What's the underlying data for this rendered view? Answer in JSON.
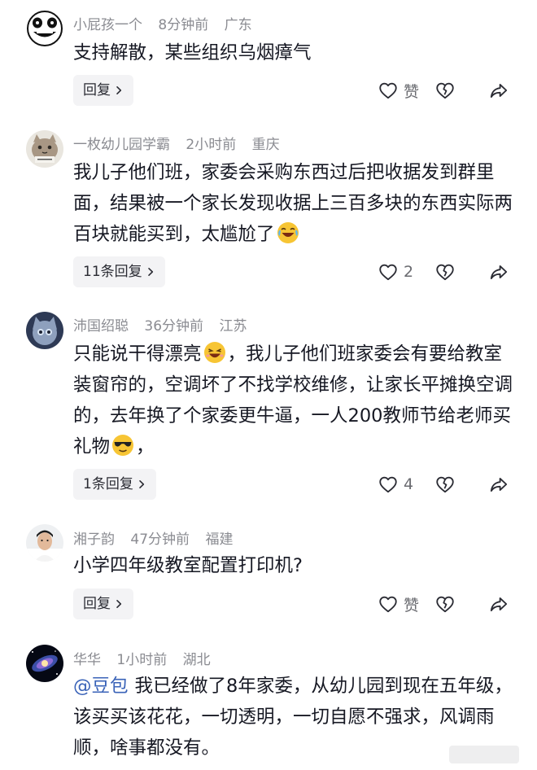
{
  "comments": [
    {
      "username": "小屁孩一个",
      "time": "8分钟前",
      "location": "广东",
      "text": "支持解散，某些组织乌烟瘴气",
      "reply_label": "回复",
      "like_label": "赞"
    },
    {
      "username": "一枚幼儿园学霸",
      "time": "2小时前",
      "location": "重庆",
      "text": "我儿子他们班，家委会采购东西过后把收据发到群里面，结果被一个家长发现收据上三百多块的东西实际两百块就能买到，太尴尬了",
      "emoji": "laughing-crying-emoji",
      "reply_label": "11条回复",
      "like_label": "2"
    },
    {
      "username": "沛国绍聪",
      "time": "36分钟前",
      "location": "江苏",
      "text_a": "只能说干得漂亮",
      "text_b": "，我儿子他们班家委会有要给教室装窗帘的，空调坏了不找学校维修，让家长平摊换空调的，去年换了个家委更牛逼，一人200教师节给老师买礼物",
      "text_c": "，",
      "emoji_a": "laughing-emoji",
      "emoji_b": "sunglasses-emoji",
      "reply_label": "1条回复",
      "like_label": "4"
    },
    {
      "username": "湘子韵",
      "time": "47分钟前",
      "location": "福建",
      "text": "小学四年级教室配置打印机?",
      "reply_label": "回复",
      "like_label": "赞"
    },
    {
      "username": "华华",
      "time": "1小时前",
      "location": "湖北",
      "mention": "@豆包",
      "text": "我已经做了8年家委，从幼儿园到现在五年级，该买买该花花，一切透明，一切自愿不强求，风调雨顺，啥事都没有。"
    }
  ],
  "icons": {
    "like": "heart-icon",
    "dislike": "broken-heart-icon",
    "share": "share-arrow-icon",
    "reply_chevron": "chevron-right-icon"
  },
  "colors": {
    "text": "#161823",
    "meta": "#8a8b91",
    "mention": "#3a63b8",
    "button_bg": "#f3f3f5"
  }
}
